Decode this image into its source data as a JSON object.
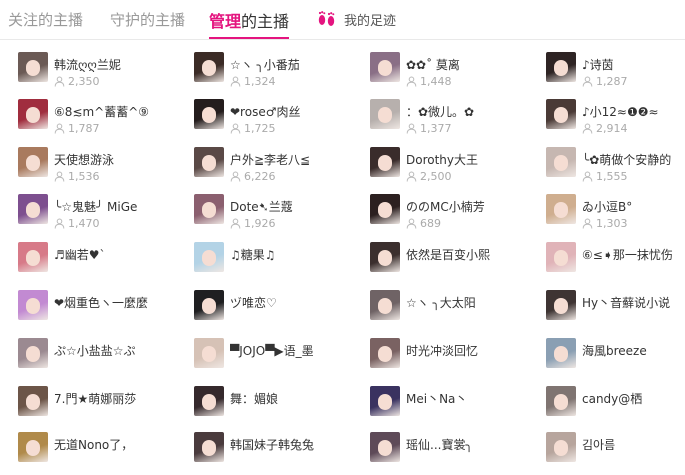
{
  "tabs": [
    {
      "label": "关注的主播"
    },
    {
      "label": "守护的主播"
    },
    {
      "label_hl": "管理",
      "label_rest": "的主播"
    },
    {
      "label": "我的足迹",
      "icon": "footprints-icon"
    }
  ],
  "colors": {
    "accent": "#e4147f",
    "tab_inactive": "#999999",
    "fans_text": "#aaaaaa"
  },
  "anchors": [
    {
      "name": "韩流ღღ兰妮",
      "fans": "2,350",
      "avatar_color": "#6b5a55"
    },
    {
      "name": "☆ヽ ╮小番茄",
      "fans": "1,324",
      "avatar_color": "#3b2b26"
    },
    {
      "name": "✿✿˚ 莫离",
      "fans": "1,448",
      "avatar_color": "#8a6f86"
    },
    {
      "name": "♪诗茵",
      "fans": "1,287",
      "avatar_color": "#2e2424"
    },
    {
      "name": "⑥8≲m^蓄蓄^⑨",
      "fans": "1,787",
      "avatar_color": "#a02d3e"
    },
    {
      "name": "❤rose♂肉丝",
      "fans": "1,725",
      "avatar_color": "#241d1d"
    },
    {
      "name": "：✿微儿。✿",
      "fans": "1,377",
      "avatar_color": "#b7b0ad"
    },
    {
      "name": "♪小12≈❶❷≈",
      "fans": "2,914",
      "avatar_color": "#4a3a36"
    },
    {
      "name": "天使想游泳",
      "fans": "1,536",
      "avatar_color": "#a97a5e"
    },
    {
      "name": "户外≧李老八≦",
      "fans": "6,226",
      "avatar_color": "#5a4946"
    },
    {
      "name": "Dorothy大王",
      "fans": "2,500",
      "avatar_color": "#3a2c2b"
    },
    {
      "name": "╰✿萌做个安静的",
      "fans": "1,555",
      "avatar_color": "#c6b7b1"
    },
    {
      "name": "╰☆鬼魅╯ MiGe",
      "fans": "1,470",
      "avatar_color": "#7d4f8f"
    },
    {
      "name": "Dote➷兰蔻",
      "fans": "1,926",
      "avatar_color": "#8b5f6f"
    },
    {
      "name": "ののMC小楠芳",
      "fans": "689",
      "avatar_color": "#2c2020"
    },
    {
      "name": "ゐ小逗B°",
      "fans": "1,303",
      "avatar_color": "#cfae8f"
    },
    {
      "name": "♬幽若♥`",
      "fans": "",
      "avatar_color": "#d77a88"
    },
    {
      "name": "♫糖果♫",
      "fans": "",
      "avatar_color": "#b3d3e6"
    },
    {
      "name": "依然是百变小熙",
      "fans": "",
      "avatar_color": "#3b2f2e"
    },
    {
      "name": "⑥≤➧那一抹忧伤",
      "fans": "",
      "avatar_color": "#e0b3b8"
    },
    {
      "name": "❤烟重色ヽ一麼麼",
      "fans": "",
      "avatar_color": "#c28ad2"
    },
    {
      "name": "ヅ唯恋♡",
      "fans": "",
      "avatar_color": "#1f1f21"
    },
    {
      "name": "☆ヽ ╮大太阳",
      "fans": "",
      "avatar_color": "#6f6365"
    },
    {
      "name": "Hy丶音蘚说小说",
      "fans": "",
      "avatar_color": "#3e3433"
    },
    {
      "name": "ぷ☆小盐盐☆ぷ",
      "fans": "",
      "avatar_color": "#9b8a91"
    },
    {
      "name": "▀JOJO▀▶语_墨",
      "fans": "",
      "avatar_color": "#d6c2b6"
    },
    {
      "name": "时光冲淡回忆",
      "fans": "",
      "avatar_color": "#7a6262"
    },
    {
      "name": "海風breeze",
      "fans": "",
      "avatar_color": "#8a9fb3"
    },
    {
      "name": "7.門★萌娜丽莎",
      "fans": "",
      "avatar_color": "#6c5548"
    },
    {
      "name": "舞：媚娘",
      "fans": "",
      "avatar_color": "#35292c"
    },
    {
      "name": "Mei丶Na丶",
      "fans": "",
      "avatar_color": "#3a3260"
    },
    {
      "name": "candy@栖",
      "fans": "",
      "avatar_color": "#7f7471"
    },
    {
      "name": "无道Nono了，",
      "fans": "",
      "avatar_color": "#b08a4a"
    },
    {
      "name": "韩国妹子韩兔兔",
      "fans": "",
      "avatar_color": "#4a3b3d"
    },
    {
      "name": "瑶仙...寶裳╮",
      "fans": "",
      "avatar_color": "#5e4a58"
    },
    {
      "name": "김아름",
      "fans": "",
      "avatar_color": "#b7a59d"
    }
  ]
}
